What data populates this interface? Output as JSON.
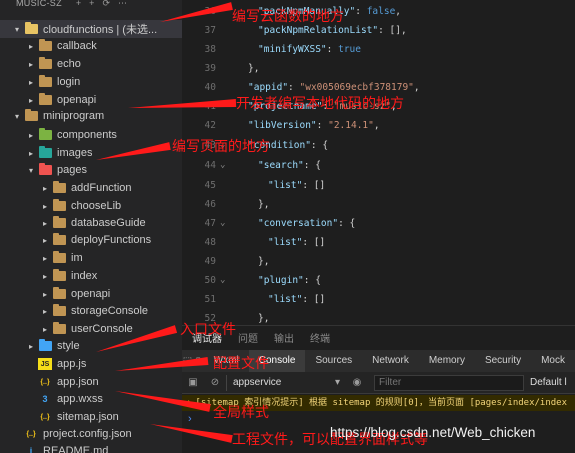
{
  "explorer": {
    "title": "MUSIC-SZ",
    "top_actions": [
      "+",
      "+",
      "⟳",
      "⋯"
    ],
    "items": [
      {
        "label": "cloudfunctions | (未选...",
        "icon": "cloud-folder-icon",
        "color": "#e8c464",
        "indent": 1,
        "expanded": true,
        "chevron": "▾",
        "selected": true,
        "interactable": true
      },
      {
        "label": "callback",
        "icon": "folder-icon",
        "color": "#c09553",
        "indent": 2,
        "chevron": "▸"
      },
      {
        "label": "echo",
        "icon": "folder-icon",
        "color": "#c09553",
        "indent": 2,
        "chevron": "▸"
      },
      {
        "label": "login",
        "icon": "folder-icon",
        "color": "#c09553",
        "indent": 2,
        "chevron": "▸"
      },
      {
        "label": "openapi",
        "icon": "folder-icon",
        "color": "#c09553",
        "indent": 2,
        "chevron": "▸"
      },
      {
        "label": "miniprogram",
        "icon": "folder-icon",
        "color": "#c09553",
        "indent": 1,
        "chevron": "▾"
      },
      {
        "label": "components",
        "icon": "components-folder-icon",
        "color": "#7cb342",
        "indent": 2,
        "chevron": "▸"
      },
      {
        "label": "images",
        "icon": "images-folder-icon",
        "color": "#26a69a",
        "indent": 2,
        "chevron": "▸"
      },
      {
        "label": "pages",
        "icon": "pages-folder-icon",
        "color": "#ef5350",
        "indent": 2,
        "chevron": "▾"
      },
      {
        "label": "addFunction",
        "icon": "folder-icon",
        "color": "#c09553",
        "indent": 3,
        "chevron": "▸"
      },
      {
        "label": "chooseLib",
        "icon": "folder-icon",
        "color": "#c09553",
        "indent": 3,
        "chevron": "▸"
      },
      {
        "label": "databaseGuide",
        "icon": "folder-icon",
        "color": "#c09553",
        "indent": 3,
        "chevron": "▸"
      },
      {
        "label": "deployFunctions",
        "icon": "folder-icon",
        "color": "#c09553",
        "indent": 3,
        "chevron": "▸"
      },
      {
        "label": "im",
        "icon": "folder-icon",
        "color": "#c09553",
        "indent": 3,
        "chevron": "▸"
      },
      {
        "label": "index",
        "icon": "folder-icon",
        "color": "#c09553",
        "indent": 3,
        "chevron": "▸"
      },
      {
        "label": "openapi",
        "icon": "folder-icon",
        "color": "#c09553",
        "indent": 3,
        "chevron": "▸"
      },
      {
        "label": "storageConsole",
        "icon": "folder-icon",
        "color": "#c09553",
        "indent": 3,
        "chevron": "▸"
      },
      {
        "label": "userConsole",
        "icon": "folder-icon",
        "color": "#c09553",
        "indent": 3,
        "chevron": "▸"
      },
      {
        "label": "style",
        "icon": "style-folder-icon",
        "color": "#42a5f5",
        "indent": 2,
        "chevron": "▸"
      },
      {
        "label": "app.js",
        "icon": "js-file-icon",
        "color": "#f5de19",
        "indent": 2,
        "chevron": "",
        "glyph": "JS"
      },
      {
        "label": "app.json",
        "icon": "json-file-icon",
        "color": "#f5c518",
        "indent": 2,
        "chevron": "",
        "glyph": "{..}"
      },
      {
        "label": "app.wxss",
        "icon": "wxss-file-icon",
        "color": "#42a5f5",
        "indent": 2,
        "chevron": "",
        "glyph": "3"
      },
      {
        "label": "sitemap.json",
        "icon": "json-file-icon",
        "color": "#f5c518",
        "indent": 2,
        "chevron": "",
        "glyph": "{..}"
      },
      {
        "label": "project.config.json",
        "icon": "json-file-icon",
        "color": "#f5c518",
        "indent": 1,
        "chevron": "",
        "glyph": "{..}"
      },
      {
        "label": "README.md",
        "icon": "markdown-file-icon",
        "color": "#42a5f5",
        "indent": 1,
        "chevron": "",
        "glyph": "i"
      }
    ]
  },
  "editor": {
    "lines": [
      {
        "n": "36",
        "fold": "",
        "html": "<span class='k'>\"packNpmManually\"</span><span class='p'>: </span><span class='b'>false</span><span class='p'>,</span>",
        "indent": 1
      },
      {
        "n": "37",
        "fold": "",
        "html": "<span class='k'>\"packNpmRelationList\"</span><span class='p'>: [],</span>",
        "indent": 1
      },
      {
        "n": "38",
        "fold": "",
        "html": "<span class='k'>\"minifyWXSS\"</span><span class='p'>: </span><span class='b'>true</span>",
        "indent": 1
      },
      {
        "n": "39",
        "fold": "",
        "html": "<span class='p'>},</span>",
        "indent": 0
      },
      {
        "n": "40",
        "fold": "",
        "html": "<span class='k'>\"appid\"</span><span class='p'>: </span><span class='s'>\"wx005069ecbf378179\"</span><span class='p'>,</span>",
        "indent": 0
      },
      {
        "n": "41",
        "fold": "",
        "html": "<span class='k'>\"projectname\"</span><span class='p'>: </span><span class='s'>\"music-sz\"</span><span class='p'>,</span>",
        "indent": 0
      },
      {
        "n": "42",
        "fold": "",
        "html": "<span class='k'>\"libVersion\"</span><span class='p'>: </span><span class='s'>\"2.14.1\"</span><span class='p'>,</span>",
        "indent": 0
      },
      {
        "n": "43",
        "fold": "⌄",
        "html": "<span class='k'>\"condition\"</span><span class='p'>: {</span>",
        "indent": 0
      },
      {
        "n": "44",
        "fold": "⌄",
        "html": "<span class='k'>\"search\"</span><span class='p'>: {</span>",
        "indent": 1
      },
      {
        "n": "45",
        "fold": "",
        "html": "<span class='k'>\"list\"</span><span class='p'>: []</span>",
        "indent": 2
      },
      {
        "n": "46",
        "fold": "",
        "html": "<span class='p'>},</span>",
        "indent": 1
      },
      {
        "n": "47",
        "fold": "⌄",
        "html": "<span class='k'>\"conversation\"</span><span class='p'>: {</span>",
        "indent": 1
      },
      {
        "n": "48",
        "fold": "",
        "html": "<span class='k'>\"list\"</span><span class='p'>: []</span>",
        "indent": 2
      },
      {
        "n": "49",
        "fold": "",
        "html": "<span class='p'>},</span>",
        "indent": 1
      },
      {
        "n": "50",
        "fold": "⌄",
        "html": "<span class='k'>\"plugin\"</span><span class='p'>: {</span>",
        "indent": 1
      },
      {
        "n": "51",
        "fold": "",
        "html": "<span class='k'>\"list\"</span><span class='p'>: []</span>",
        "indent": 2
      },
      {
        "n": "52",
        "fold": "",
        "html": "<span class='p'>},</span>",
        "indent": 1
      }
    ]
  },
  "panel": {
    "tabs": [
      "调试器",
      "问题",
      "输出",
      "终端"
    ],
    "devtools_tabs": [
      "Wxml",
      "Console",
      "Sources",
      "Network",
      "Memory",
      "Security",
      "Mock"
    ],
    "active_devtools_tab": "Console",
    "context": "appservice",
    "filter_placeholder": "Filter",
    "level": "Default l",
    "warning": "[sitemap 索引情况提示] 根据 sitemap 的规则[0]，当前页面 [pages/index/index",
    "prompt": "›"
  },
  "annotations": [
    {
      "text": "编写云函数的地方",
      "tail": [
        [
          160,
          22
        ],
        [
          232,
          6
        ]
      ]
    },
    {
      "text": "开发者编写本地代码的地方",
      "tail": [
        [
          128,
          108
        ],
        [
          236,
          103
        ]
      ]
    },
    {
      "text": "编写页面的地方",
      "tail": [
        [
          96,
          160
        ],
        [
          170,
          146
        ]
      ]
    },
    {
      "text": "入口文件",
      "tail": [
        [
          96,
          352
        ],
        [
          176,
          329
        ]
      ]
    },
    {
      "text": "配置文件",
      "tail": [
        [
          115,
          371
        ],
        [
          208,
          361
        ]
      ]
    },
    {
      "text": "全局样式",
      "tail": [
        [
          115,
          391
        ],
        [
          210,
          408
        ]
      ]
    },
    {
      "text": "工程文件，可以配置界面样式等",
      "tail": [
        [
          150,
          424
        ],
        [
          232,
          439
        ]
      ]
    }
  ],
  "watermark": "https://blog.csdn.net/Web_chicken",
  "colors": {
    "annotation": "#ff1a1a",
    "selected_row": "#37373d",
    "sidebar": "#252526",
    "editor": "#1e1e1e"
  }
}
